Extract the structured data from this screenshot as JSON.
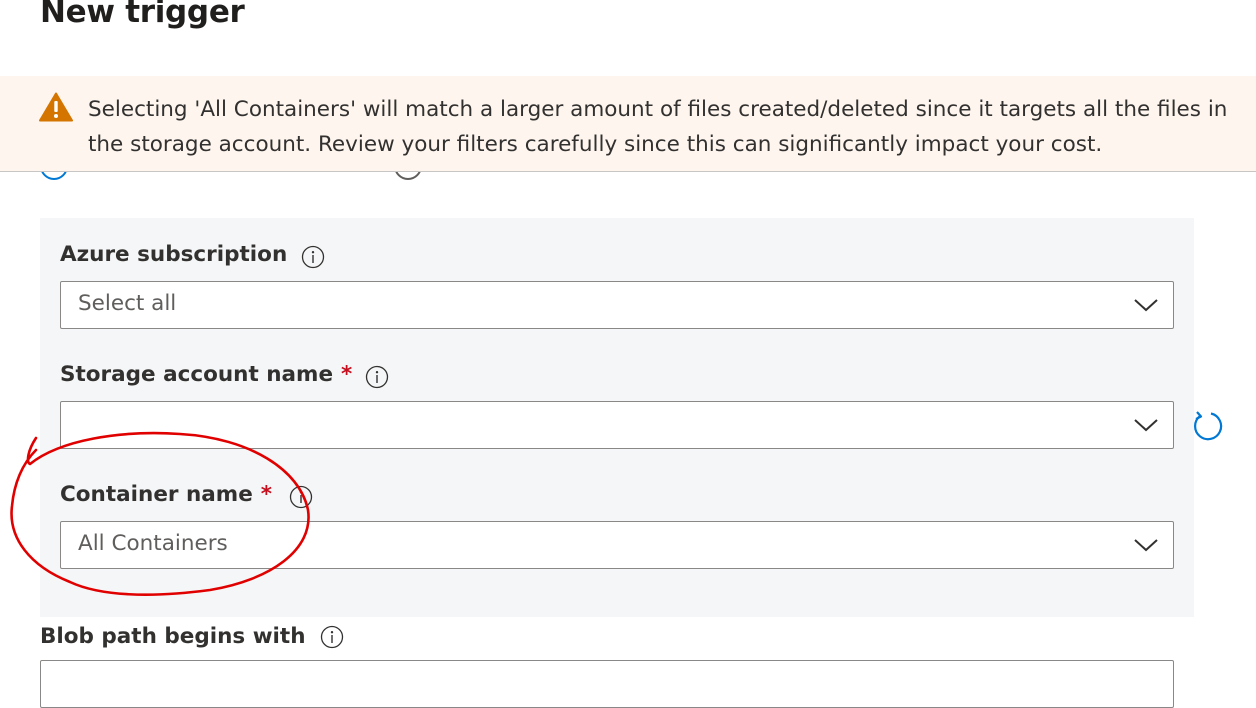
{
  "page": {
    "title": "New trigger"
  },
  "warning": {
    "icon": "warning-triangle-icon",
    "color": "#d47500",
    "message": "Selecting 'All Containers' will match a larger amount of files created/deleted since it targets all the files in the storage account. Review your filters carefully since this can significantly impact your cost."
  },
  "form": {
    "azure_subscription": {
      "label": "Azure subscription",
      "value": "Select all"
    },
    "storage_account_name": {
      "label": "Storage account name",
      "required_mark": "*",
      "value": ""
    },
    "container_name": {
      "label": "Container name",
      "required_mark": "*",
      "value": "All Containers"
    },
    "blob_path_begins_with": {
      "label": "Blob path begins with",
      "value": ""
    }
  },
  "colors": {
    "accent": "#0078d4",
    "required": "#c50f1f",
    "annotation": "#e00000",
    "panel_background": "#f5f6f7",
    "warning_background": "#fdf5ee"
  }
}
